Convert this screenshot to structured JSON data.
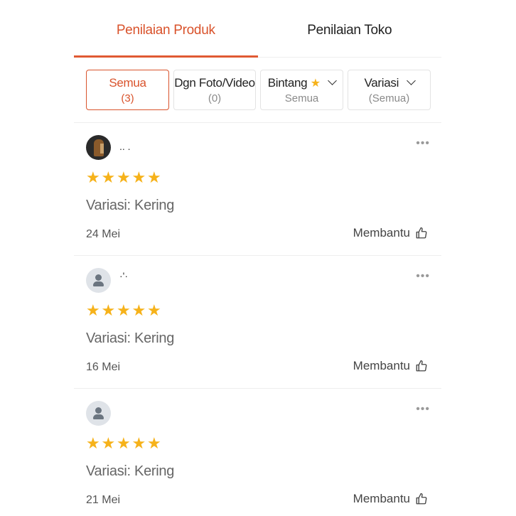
{
  "tabs": [
    {
      "label": "Penilaian Produk",
      "active": true
    },
    {
      "label": "Penilaian Toko",
      "active": false
    }
  ],
  "filters": [
    {
      "label": "Semua",
      "sub": "(3)",
      "active": true
    },
    {
      "label": "Dgn Foto/Video",
      "sub": "(0)",
      "active": false
    },
    {
      "label": "Bintang",
      "sub": "Semua",
      "icon": "star-icon",
      "dropdown": true
    },
    {
      "label": "Variasi",
      "sub": "(Semua)",
      "dropdown": true
    }
  ],
  "reviews": [
    {
      "username": ".. .",
      "avatar": "photo",
      "rating": 5,
      "variation": "Variasi: Kering",
      "date": "24 Mei",
      "helpful_label": "Membantu"
    },
    {
      "username": "·'·",
      "avatar": "default",
      "rating": 5,
      "variation": "Variasi: Kering",
      "date": "16 Mei",
      "helpful_label": "Membantu"
    },
    {
      "username": "",
      "avatar": "default",
      "rating": 5,
      "variation": "Variasi: Kering",
      "date": "21 Mei",
      "helpful_label": "Membantu"
    }
  ],
  "icons": {
    "more": "•••",
    "star": "★"
  },
  "colors": {
    "accent": "#d9532c",
    "star": "#f6b21a"
  }
}
